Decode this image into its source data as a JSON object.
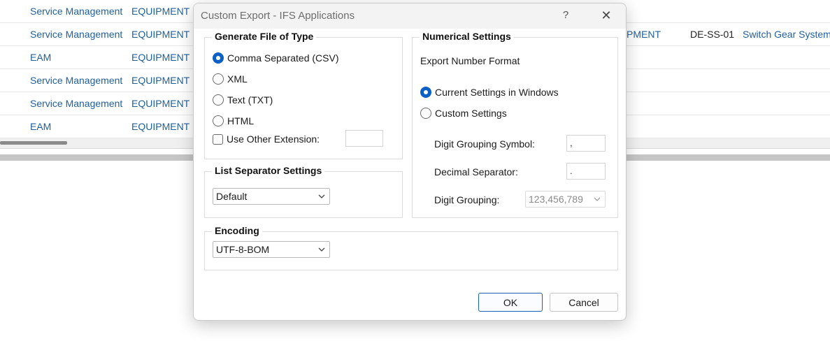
{
  "background": {
    "rows": [
      {
        "col1": "Service Management",
        "col2": "EQUIPMENT",
        "col3": "",
        "col4": "",
        "col5": ""
      },
      {
        "col1": "Service Management",
        "col2": "EQUIPMENT",
        "col3": "PMENT",
        "col4": "DE-SS-01",
        "col5": "Switch Gear System"
      },
      {
        "col1": "EAM",
        "col2": "EQUIPMENT",
        "col3": "",
        "col4": "",
        "col5": ""
      },
      {
        "col1": "Service Management",
        "col2": "EQUIPMENT",
        "col3": "",
        "col4": "",
        "col5": ""
      },
      {
        "col1": "Service Management",
        "col2": "EQUIPMENT",
        "col3": "",
        "col4": "",
        "col5": ""
      },
      {
        "col1": "EAM",
        "col2": "EQUIPMENT",
        "col3": "",
        "col4": "",
        "col5": ""
      }
    ]
  },
  "dialog": {
    "title": "Custom Export - IFS Applications",
    "help_label": "?",
    "close_label": "✕",
    "file_type": {
      "title": "Generate File of Type",
      "options": [
        "Comma Separated (CSV)",
        "XML",
        "Text (TXT)",
        "HTML"
      ],
      "selected": "Comma Separated (CSV)",
      "other_extension_label": "Use Other Extension:",
      "other_extension_value": "",
      "other_extension_checked": false
    },
    "list_separator": {
      "title": "List Separator Settings",
      "value": "Default"
    },
    "encoding": {
      "title": "Encoding",
      "value": "UTF-8-BOM"
    },
    "numerical": {
      "title": "Numerical Settings",
      "export_number_format_label": "Export Number Format",
      "options": [
        "Current Settings in Windows",
        "Custom Settings"
      ],
      "selected": "Current Settings in Windows",
      "digit_grouping_symbol_label": "Digit Grouping Symbol:",
      "digit_grouping_symbol_value": ",",
      "decimal_separator_label": "Decimal Separator:",
      "decimal_separator_value": ".",
      "digit_grouping_label": "Digit Grouping:",
      "digit_grouping_value": "123,456,789"
    },
    "ok_label": "OK",
    "cancel_label": "Cancel"
  },
  "colors": {
    "link": "#1f5f9c",
    "accent": "#0a60c4",
    "primary_border": "#1a5fb8"
  }
}
